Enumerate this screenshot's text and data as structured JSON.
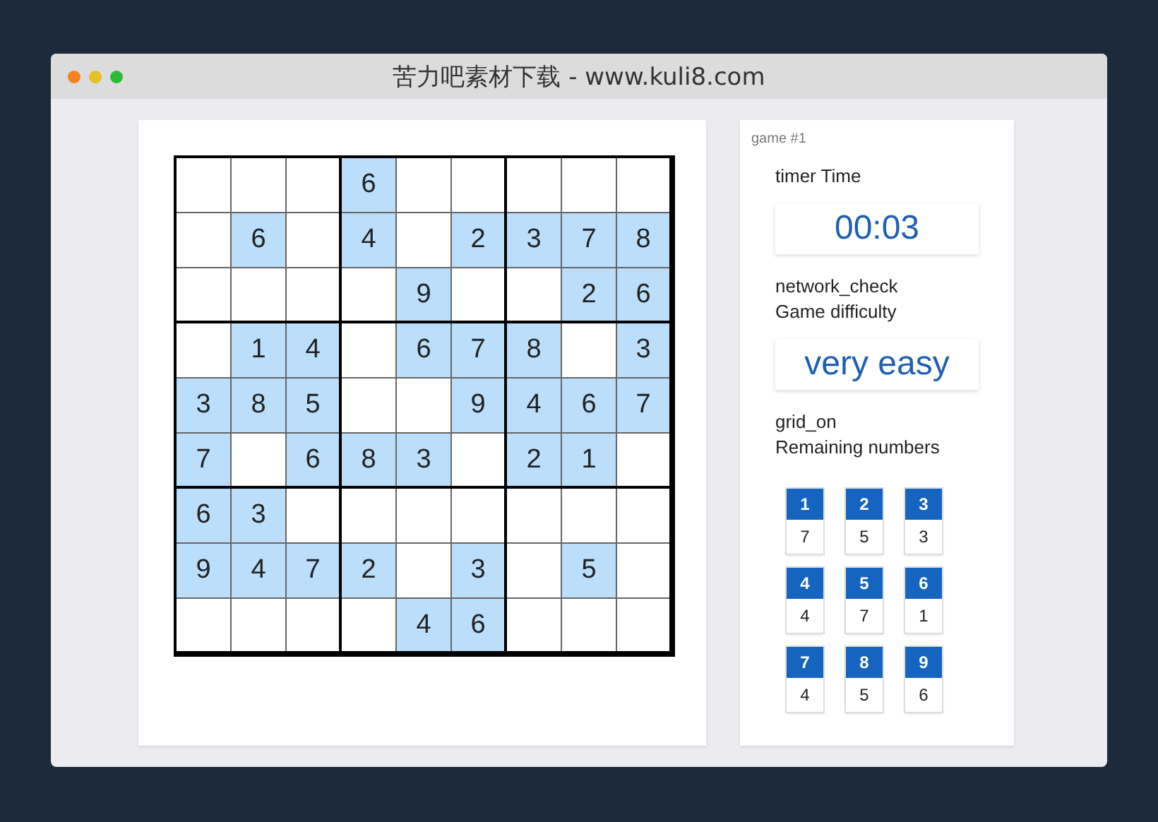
{
  "window": {
    "title": "苦力吧素材下载 - www.kuli8.com"
  },
  "board": {
    "rows": [
      [
        null,
        null,
        null,
        "6",
        null,
        null,
        null,
        null,
        null
      ],
      [
        null,
        "6",
        null,
        "4",
        null,
        "2",
        "3",
        "7",
        "8"
      ],
      [
        null,
        null,
        null,
        null,
        "9",
        null,
        null,
        "2",
        "6"
      ],
      [
        null,
        "1",
        "4",
        null,
        "6",
        "7",
        "8",
        null,
        "3"
      ],
      [
        "3",
        "8",
        "5",
        null,
        null,
        "9",
        "4",
        "6",
        "7"
      ],
      [
        "7",
        null,
        "6",
        "8",
        "3",
        null,
        "2",
        "1",
        null
      ],
      [
        "6",
        "3",
        null,
        null,
        null,
        null,
        null,
        null,
        null
      ],
      [
        "9",
        "4",
        "7",
        "2",
        null,
        "3",
        null,
        "5",
        null
      ],
      [
        null,
        null,
        null,
        null,
        "4",
        "6",
        null,
        null,
        null
      ]
    ]
  },
  "panel": {
    "game_label": "game #1",
    "timer_label": "timer Time",
    "timer_value": "00:03",
    "difficulty_label_1": "network_check",
    "difficulty_label_2": "Game difficulty",
    "difficulty_value": "very easy",
    "remaining_label_1": "grid_on",
    "remaining_label_2": "Remaining numbers",
    "remaining": [
      {
        "number": "1",
        "count": "7"
      },
      {
        "number": "2",
        "count": "5"
      },
      {
        "number": "3",
        "count": "3"
      },
      {
        "number": "4",
        "count": "4"
      },
      {
        "number": "5",
        "count": "7"
      },
      {
        "number": "6",
        "count": "1"
      },
      {
        "number": "7",
        "count": "4"
      },
      {
        "number": "8",
        "count": "5"
      },
      {
        "number": "9",
        "count": "6"
      }
    ]
  }
}
